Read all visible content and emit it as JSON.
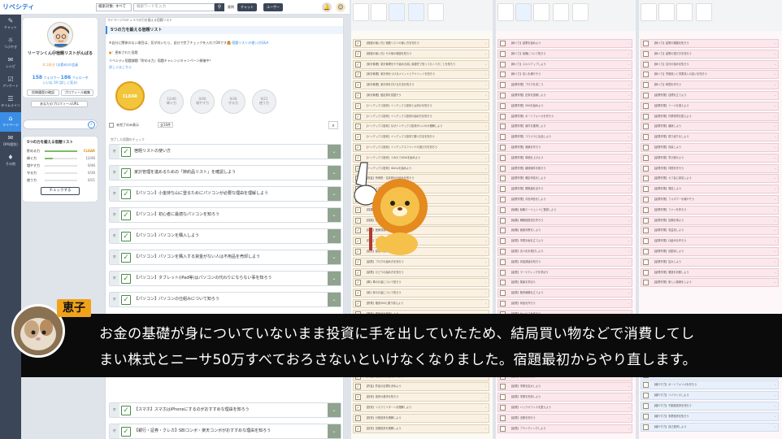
{
  "topbar": {
    "logo": "リベシティ",
    "category": "検索対象: すべて",
    "search_placeholder": "検索ワードを入力",
    "search_btn": "⚲",
    "help": "質問",
    "chat_btn": "チャット",
    "user_btn": "ユーザー"
  },
  "rail": [
    {
      "icon": "✎",
      "label": "チャット"
    },
    {
      "icon": "☼",
      "label": "つぶやき"
    },
    {
      "icon": "✉",
      "label": "レシピ"
    },
    {
      "icon": "☑",
      "label": "アンケート"
    },
    {
      "icon": "☰",
      "label": "タイムライン"
    },
    {
      "icon": "⌂",
      "label": "マイページ"
    },
    {
      "icon": "✉",
      "label": "DM(個別)"
    },
    {
      "icon": "♦",
      "label": "その他"
    }
  ],
  "profile": {
    "name": "リーマンくん＠宿題リストがんばる",
    "tag1": "ネコ好き",
    "tag2": "(お勤め)の会員",
    "followers": "158",
    "followers_lbl": "フォロワー",
    "following": "186",
    "following_lbl": "フォロー中",
    "likes": "いいね 19",
    "likes2": "(詳しく見る)",
    "edit_btn": "投稿履歴の確認",
    "profile_btn": "プロフィール編集",
    "url_btn": "あなたのプロフィールURL"
  },
  "skills": {
    "title": "5つの力を鍛える宿題リスト",
    "check_btn": "チェックする",
    "rows": [
      {
        "label": "貯める力",
        "value": "CLEAR",
        "fill": 1.0,
        "clear": true
      },
      {
        "label": "稼ぐ力",
        "value": "12/46",
        "fill": 0.26,
        "clear": false
      },
      {
        "label": "増やす力",
        "value": "0/46",
        "fill": 0.0,
        "clear": false
      },
      {
        "label": "守る力",
        "value": "0/36",
        "fill": 0.0,
        "clear": false
      },
      {
        "label": "使う力",
        "value": "0/21",
        "fill": 0.0,
        "clear": false
      }
    ]
  },
  "main": {
    "breadcrumb": "マイページTOP > 5つの力を鍛える宿題リスト",
    "title": "5つの力を鍛える宿題リスト",
    "intro": "※自分に関係のない項目は、気が向いたら、自分で完了チェックを入れてOKです🙆",
    "intro_link": "宿題リストの使い方Q&A",
    "updated": "：更新された宿題",
    "campaign": "リベシティ宿題課題「貯める力」宿題チャレンジキャンペーン開催中！",
    "campaign_link": "詳しくはこちら",
    "clear_badge": "CLEAR",
    "badges": [
      {
        "v": "12/46",
        "l": "稼ぐ力"
      },
      {
        "v": "0/46",
        "l": "増やす力"
      },
      {
        "v": "0/36",
        "l": "守る力"
      },
      {
        "v": "0/21",
        "l": "使う力"
      }
    ],
    "filter_label": "未完了のみ表示",
    "filter_count": "全10件",
    "done_header": "完了した宿題のチェック",
    "rows": [
      "宿題リストの使い方",
      "家計管理を進めるための「節約品リスト」を確認しよう",
      "【パソコン】小金持ち山に登るためにパソコンが必要な理由を理解しよう",
      "【パソコン】初心者に最適なパソコンを知ろう",
      "【パソコン】パソコンを購入しよう",
      "【パソコン】パソコンを購入する資金がない人は不用品を売却しよう",
      "【パソコン】タブレット(iPad等)はパソコンの代わりにならない事を知ろう",
      "【パソコン】パソコンの仕組みについて知ろう",
      "【スマホ】スマホはiPhoneにするのがおすすめな理由を知ろう",
      "【銀行・証券・クレカ】SBIコンボ・楽天コンボがおすすめな理由を知ろう",
      "【銀行・証券・クレカ】SBIコンボを選んだ人は、SBIコンボを完成させよう"
    ],
    "row_nums": [
      "貯",
      "貯",
      "貯",
      "貯",
      "貯",
      "貯",
      "貯",
      "貯",
      "貯",
      "貯",
      "貯"
    ]
  },
  "col_orange": [
    "【宿題の使い方】宿題リストの使い方を知ろう",
    "【宿題の使い方】その他の宿題を知ろう",
    "【家計管理】家計管理をやり始める前に最優先で知っておくべきことを知ろう",
    "【家計管理】家計簿をつけるメリットとデメリットを知ろう",
    "【家計管理】家計簿を付ける方法を知ろう",
    "【家計管理】固定費を見直そう",
    "【インデックス投資】インデックス投資とは何かを知ろう",
    "【インデックス投資】インデックス投資の始め方を知ろう",
    "【インデックス投資】なぜインデックス投資がいいのか理解しよう",
    "【インデックス投資】インデックス投資で勝つ方法を知ろう",
    "【インデックス投資】インデックスファンドの選び方を知ろう",
    "【インデックス投資】つみたてNISAを始めよう",
    "【インデックス投資】iDeCoを始めよう",
    "【税金】所得税・住民税の仕組みを知ろう",
    "【税金】ふるさと納税のメリットを知ろう",
    "【税金】ふるさと納税を始めよう",
    "【保険】保険の本質を知ろう",
    "【保険】保険の見直しをしよう",
    "【保険】医療保険の必要性を知ろう",
    "【保険】生命保険の必要性を知ろう",
    "【副業】副業の始め方を知ろう",
    "【副業】ブログの始め方を知ろう",
    "【副業】せどりの始め方を知ろう",
    "【車】車のお金について知ろう",
    "【家】家のお金について知ろう",
    "【携帯】格安SIMに乗り換えよう",
    "【電気】電気代を節約しよう",
    "【ガス】ガス代を節約しよう",
    "【水道】水道代を節約しよう",
    "【年金】年金の仕組みを知ろう",
    "【年金】年金の受け取り方を知ろう",
    "【貯金】先取り貯金を始めよう",
    "【貯金】生活防衛資金を貯めよう",
    "【貯金】貯金の目標を決めよう",
    "【投資】投資の基本を知ろう",
    "【投資】リスクとリターンを理解しよう",
    "【投資】分散投資を理解しよう",
    "【投資】長期投資を理解しよう"
  ],
  "col_pink1": [
    "【稼ぐ力】副業を始めよう",
    "【稼ぐ力】転職について知ろう",
    "【稼ぐ力】スキルアップしよう",
    "【稼ぐ力】収入を増やそう",
    "【副業作業】ブログを書こう",
    "【副業作業】記事を投稿しよう",
    "【副業作業】SNSを始めよう",
    "【副業作業】ポートフォリオを作ろう",
    "【副業作業】案件を獲得しよう",
    "【副業作業】ココナラに出品しよう",
    "【副業作業】実績を作ろう",
    "【副業作業】単価を上げよう",
    "【副業作業】継続案件を取ろう",
    "【副業作業】確定申告をしよう",
    "【副業作業】開業届を出そう",
    "【副業作業】青色申告をしよう",
    "【転職】転職エージェントに登録しよう",
    "【転職】職務経歴書を作ろう",
    "【転職】面接対策をしよう",
    "【起業】事業計画を立てよう",
    "【起業】法人化を検討しよう",
    "【起業】資金調達を知ろう",
    "【起業】マーケティングを学ぼう",
    "【起業】集客を学ぼう",
    "【起業】販売戦略を立てよう",
    "【起業】商品を作ろう",
    "【起業】サービスを作ろう",
    "【起業】仕組み化しよう",
    "【起業】外注しよう",
    "【起業】組織を作ろう",
    "【起業】経理を整えよう",
    "【起業】税理士を探そう",
    "【起業】節税を学ぼう",
    "【起業】事業を拡大しよう",
    "【起業】事業を売却しよう",
    "【起業】バックオフィスを整えよう",
    "【起業】法務を知ろう",
    "【起業】ブランディングしよう"
  ],
  "col_pink2": [
    "【稼ぐ力】副業の種類を知ろう",
    "【稼ぐ力】副業の選び方を知ろう",
    "【稼ぐ力】自分の強みを知ろう",
    "【稼ぐ力】労働収入と事業収入の違いを知ろう",
    "【稼ぐ力】時間を作ろう",
    "【副業作業】目標を立てよう",
    "【副業作業】ツールを揃えよう",
    "【副業作業】作業環境を整えよう",
    "【副業作業】継続しよう",
    "【副業作業】振り返りをしよう",
    "【副業作業】改善しよう",
    "【副業作業】学び続けよう",
    "【副業作業】仲間を作ろう",
    "【副業作業】オフ会に参加しよう",
    "【副業作業】発信しよう",
    "【副業作業】フォロワーを増やそう",
    "【副業作業】ファンを作ろう",
    "【副業作業】信頼を得よう",
    "【副業作業】収益化しよう",
    "【副業作業】仕組みを作ろう",
    "【副業作業】自動化しよう",
    "【副業作業】拡大しよう",
    "【副業作業】撤退を判断しよう",
    "【副業作業】新しい挑戦をしよう"
  ],
  "col_blue": [
    "【増やす力】投資の目的を知ろう",
    "【増やす力】資産運用を始めよう",
    "【増やす力】高配当株を知ろう",
    "【増やす力】ポートフォリオを作ろう",
    "【増やす力】リバランスしよう",
    "【増やす力】不動産投資を知ろう",
    "【増やす力】事業投資を知ろう",
    "【増やす力】自己投資しよう",
    "【増やす力】投資詐欺に注意しよう"
  ],
  "caption": {
    "speaker": "恵子",
    "line1": "お金の基礎が身についていないまま投資に手を出していたため、結局買い物などで消費してし",
    "line2": "まい株式とニーサ50万すべておろさないといけなくなりました。宿題最初からやり直します。"
  },
  "colors": {
    "accent": "#3a8ee6",
    "rail": "#3b4658",
    "clear": "#e2901a",
    "speaker_tag": "#f0a21a"
  }
}
